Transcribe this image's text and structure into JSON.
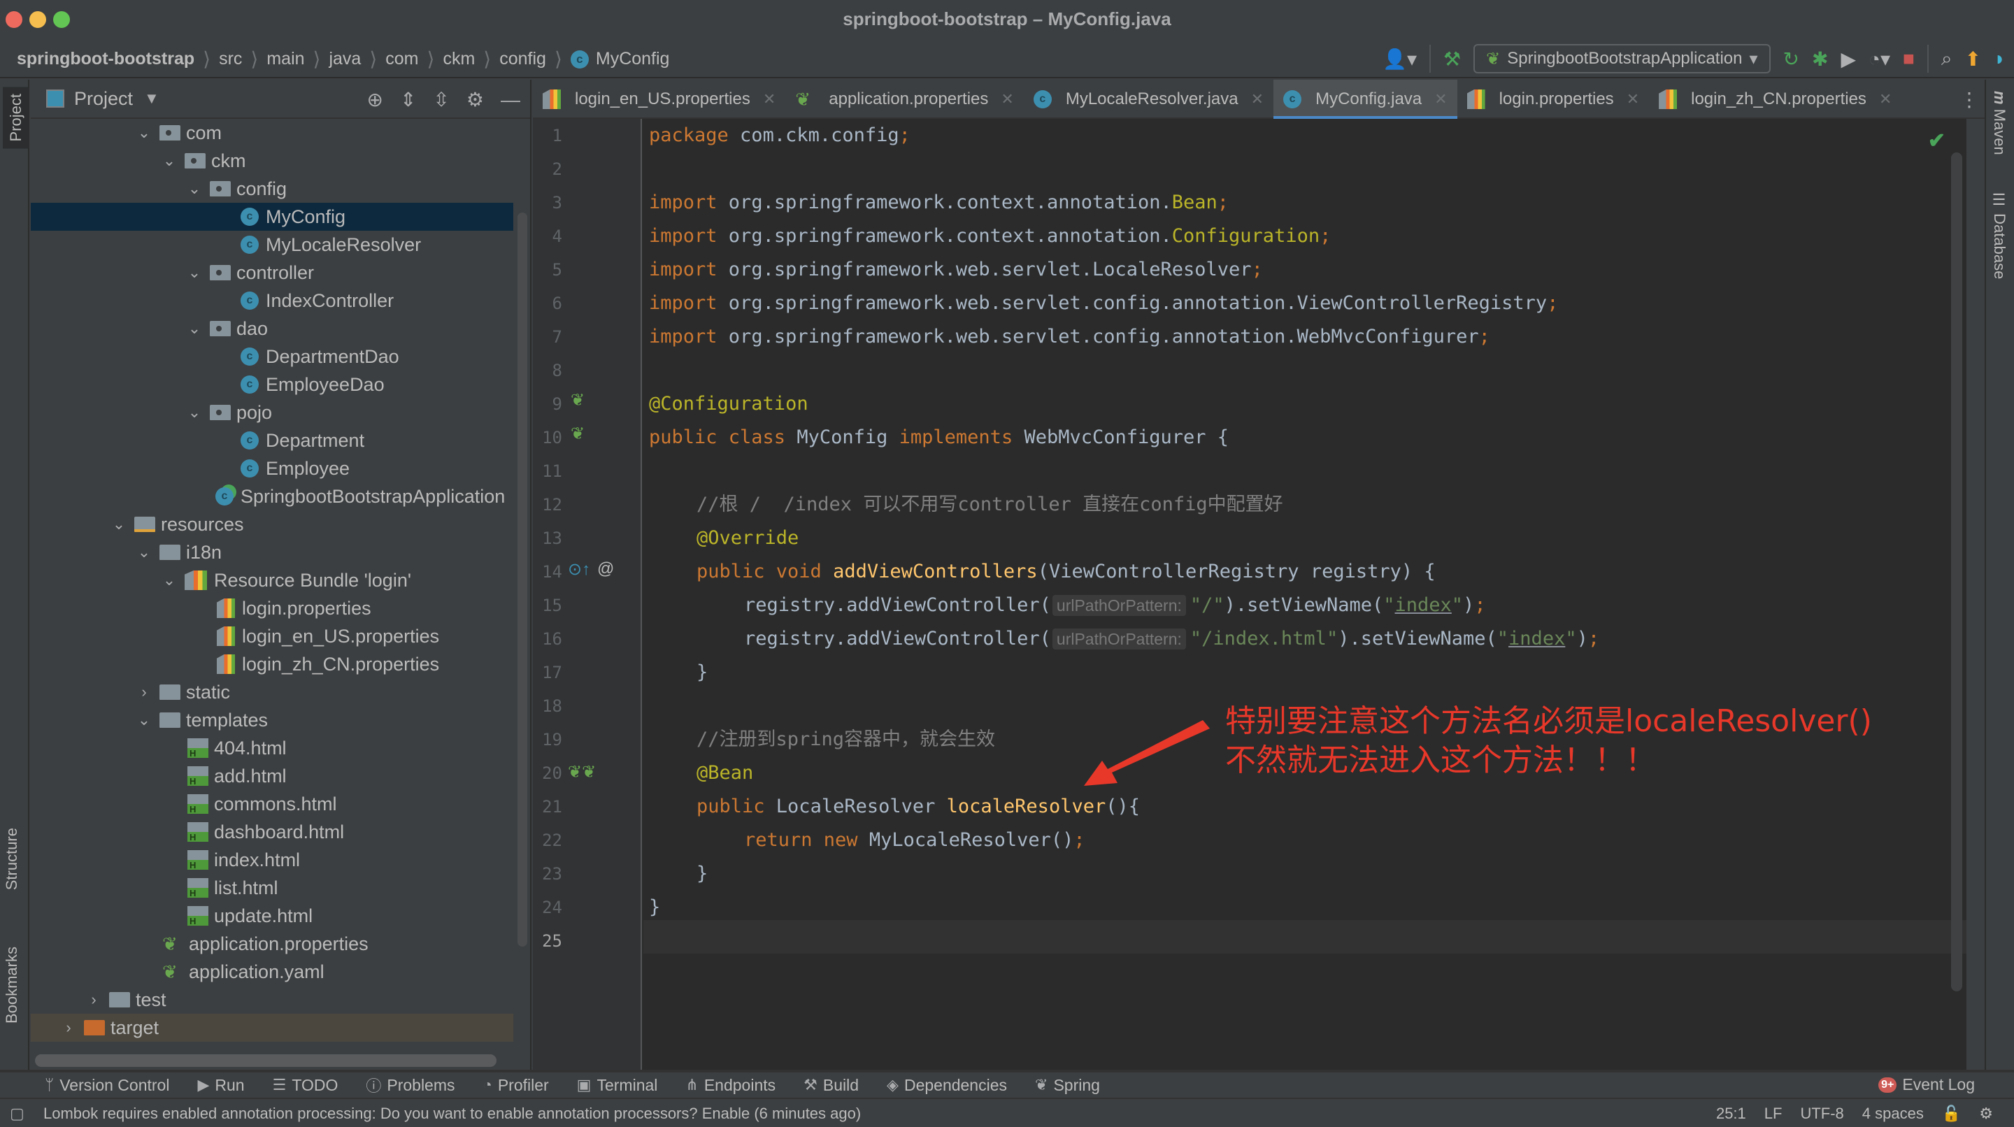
{
  "window": {
    "title": "springboot-bootstrap – MyConfig.java"
  },
  "breadcrumb": [
    "springboot-bootstrap",
    "src",
    "main",
    "java",
    "com",
    "ckm",
    "config",
    "MyConfig"
  ],
  "toolbar": {
    "run_config": "SpringbootBootstrapApplication",
    "icons": [
      "account-icon",
      "build-hammer-icon",
      "rerun-icon",
      "debug-icon",
      "coverage-icon",
      "profile-icon",
      "stop-icon",
      "search-icon",
      "update-icon",
      "toolbox-icon"
    ]
  },
  "left_strip": {
    "project": "Project",
    "structure": "Structure",
    "bookmarks": "Bookmarks"
  },
  "right_strip": {
    "maven": "Maven",
    "database": "Database"
  },
  "project_panel": {
    "title": "Project",
    "tree": [
      {
        "label": "com",
        "type": "package",
        "expanded": true
      },
      {
        "label": "ckm",
        "type": "package",
        "expanded": true
      },
      {
        "label": "config",
        "type": "package",
        "expanded": true
      },
      {
        "label": "MyConfig",
        "type": "class",
        "selected": true
      },
      {
        "label": "MyLocaleResolver",
        "type": "class"
      },
      {
        "label": "controller",
        "type": "package",
        "expanded": true
      },
      {
        "label": "IndexController",
        "type": "class"
      },
      {
        "label": "dao",
        "type": "package",
        "expanded": true
      },
      {
        "label": "DepartmentDao",
        "type": "class"
      },
      {
        "label": "EmployeeDao",
        "type": "class"
      },
      {
        "label": "pojo",
        "type": "package",
        "expanded": true
      },
      {
        "label": "Department",
        "type": "class"
      },
      {
        "label": "Employee",
        "type": "class"
      },
      {
        "label": "SpringbootBootstrapApplication",
        "type": "spring-class"
      },
      {
        "label": "resources",
        "type": "resources",
        "expanded": true
      },
      {
        "label": "i18n",
        "type": "folder",
        "expanded": true
      },
      {
        "label": "Resource Bundle 'login'",
        "type": "bundle",
        "expanded": true
      },
      {
        "label": "login.properties",
        "type": "properties"
      },
      {
        "label": "login_en_US.properties",
        "type": "properties"
      },
      {
        "label": "login_zh_CN.properties",
        "type": "properties"
      },
      {
        "label": "static",
        "type": "folder",
        "expanded": false
      },
      {
        "label": "templates",
        "type": "folder",
        "expanded": true
      },
      {
        "label": "404.html",
        "type": "html"
      },
      {
        "label": "add.html",
        "type": "html"
      },
      {
        "label": "commons.html",
        "type": "html"
      },
      {
        "label": "dashboard.html",
        "type": "html"
      },
      {
        "label": "index.html",
        "type": "html"
      },
      {
        "label": "list.html",
        "type": "html"
      },
      {
        "label": "update.html",
        "type": "html"
      },
      {
        "label": "application.properties",
        "type": "spring-config"
      },
      {
        "label": "application.yaml",
        "type": "spring-config"
      },
      {
        "label": "test",
        "type": "folder",
        "expanded": false
      },
      {
        "label": "target",
        "type": "excluded-folder",
        "expanded": false
      }
    ]
  },
  "tabs": [
    {
      "label": "login_en_US.properties",
      "type": "properties"
    },
    {
      "label": "application.properties",
      "type": "spring-config"
    },
    {
      "label": "MyLocaleResolver.java",
      "type": "class"
    },
    {
      "label": "MyConfig.java",
      "type": "class",
      "active": true
    },
    {
      "label": "login.properties",
      "type": "properties"
    },
    {
      "label": "login_zh_CN.properties",
      "type": "properties"
    }
  ],
  "editor": {
    "line_count": 25,
    "current_line": 25,
    "code": {
      "l1": {
        "kw": "package",
        "rest": " com.ckm.config"
      },
      "l3": {
        "pkg": " org.springframework.context.annotation.",
        "cls": "Bean"
      },
      "l4": {
        "pkg": " org.springframework.context.annotation.",
        "cls": "Configuration"
      },
      "l5": {
        "pkg": " org.springframework.web.servlet.LocaleResolver"
      },
      "l6": {
        "pkg": " org.springframework.web.servlet.config.annotation.ViewControllerRegistry"
      },
      "l7": {
        "pkg": " org.springframework.web.servlet.config.annotation.WebMvcConfigurer"
      },
      "import_kw": "import",
      "l9": "@Configuration",
      "l10": {
        "mods": "public class ",
        "name": "MyConfig ",
        "impl": "implements ",
        "iface": "WebMvcConfigurer {"
      },
      "l12": "//根 /  /index 可以不用写controller 直接在config中配置好",
      "l13": "@Override",
      "l14": {
        "mods": "public void ",
        "fn": "addViewControllers",
        "rest": "(ViewControllerRegistry registry) {"
      },
      "l15": {
        "call": "registry.addViewController(",
        "hint": "urlPathOrPattern:",
        "arg": "\"/\"",
        "mid": ").setViewName(",
        "q1": "\"",
        "val": "index",
        "q2": "\"",
        "end": ")"
      },
      "l16": {
        "call": "registry.addViewController(",
        "hint": "urlPathOrPattern:",
        "arg": "\"/index.html\"",
        "mid": ").setViewName(",
        "q1": "\"",
        "val": "index",
        "q2": "\"",
        "end": ")"
      },
      "l17": "}",
      "l19": "//注册到spring容器中，就会生效",
      "l20": "@Bean",
      "l21": {
        "mods": "public ",
        "type": "LocaleResolver ",
        "fn": "localeResolver",
        "rest": "(){"
      },
      "l22": {
        "kw": "return new ",
        "rest": "MyLocaleResolver()"
      },
      "l23": "}",
      "l24": "}",
      "semicolon": ";"
    }
  },
  "annotation": {
    "line1": "特别要注意这个方法名必须是localeResolver()",
    "line2": "不然就无法进入这个方法！！！",
    "color": "#e8382a"
  },
  "bottom_tools": [
    {
      "label": "Version Control",
      "icon": "version-control-icon"
    },
    {
      "label": "Run",
      "icon": "run-icon"
    },
    {
      "label": "TODO",
      "icon": "todo-icon"
    },
    {
      "label": "Problems",
      "icon": "problems-icon"
    },
    {
      "label": "Profiler",
      "icon": "profiler-icon"
    },
    {
      "label": "Terminal",
      "icon": "terminal-icon"
    },
    {
      "label": "Endpoints",
      "icon": "endpoints-icon"
    },
    {
      "label": "Build",
      "icon": "build-icon"
    },
    {
      "label": "Dependencies",
      "icon": "dependencies-icon"
    },
    {
      "label": "Spring",
      "icon": "spring-icon"
    }
  ],
  "event_log": {
    "label": "Event Log",
    "badge": "9+"
  },
  "status": {
    "message": "Lombok requires enabled annotation processing: Do you want to enable annotation processors? Enable (6 minutes ago)",
    "position": "25:1",
    "line_sep": "LF",
    "encoding": "UTF-8",
    "indent": "4 spaces"
  }
}
